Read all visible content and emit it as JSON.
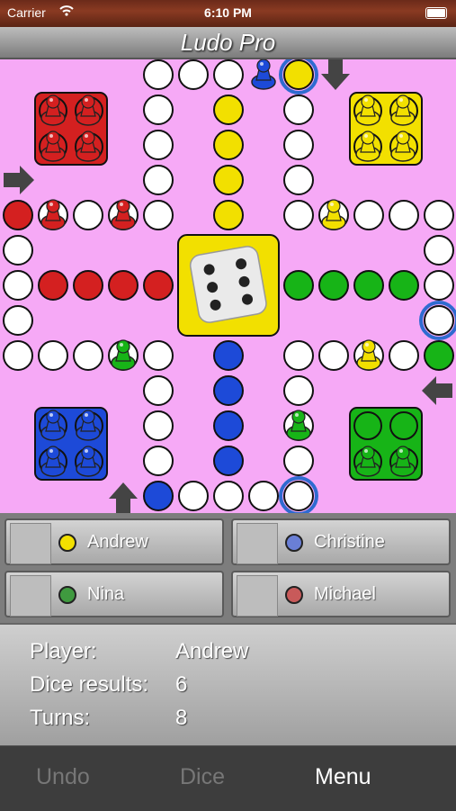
{
  "status": {
    "carrier": "Carrier",
    "time": "6:10 PM"
  },
  "app": {
    "title": "Ludo Pro"
  },
  "colors": {
    "red": "#d42020",
    "yellow": "#f2e000",
    "green": "#17b417",
    "blue": "#1d4ad8",
    "board": "#f6a9f6"
  },
  "board": {
    "dice_value": 6
  },
  "players": [
    {
      "name": "Andrew",
      "color": "#f2e000",
      "active": true
    },
    {
      "name": "Christine",
      "color": "#6a7fd6",
      "active": false
    },
    {
      "name": "Nina",
      "color": "#3f9a3f",
      "active": false
    },
    {
      "name": "Michael",
      "color": "#c85a5a",
      "active": false
    }
  ],
  "info": {
    "player_label": "Player:",
    "player_value": "Andrew",
    "dice_label": "Dice results:",
    "dice_value": "6",
    "turns_label": "Turns:",
    "turns_value": "8"
  },
  "toolbar": {
    "undo_label": "Undo",
    "dice_label": "Dice",
    "menu_label": "Menu"
  }
}
